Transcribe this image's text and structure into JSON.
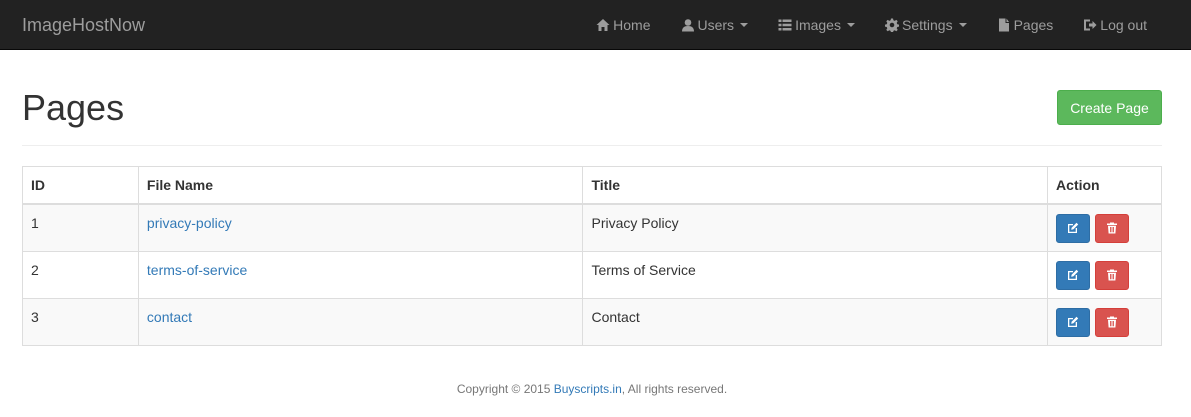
{
  "navbar": {
    "brand": "ImageHostNow",
    "items": [
      {
        "label": "Home",
        "icon": "home-icon"
      },
      {
        "label": "Users",
        "icon": "user-icon",
        "dropdown": true
      },
      {
        "label": "Images",
        "icon": "list-icon",
        "dropdown": true
      },
      {
        "label": "Settings",
        "icon": "gear-icon",
        "dropdown": true
      },
      {
        "label": "Pages",
        "icon": "file-icon"
      },
      {
        "label": "Log out",
        "icon": "logout-icon"
      }
    ]
  },
  "header": {
    "title": "Pages",
    "create_label": "Create Page"
  },
  "table": {
    "columns": [
      "ID",
      "File Name",
      "Title",
      "Action"
    ],
    "rows": [
      {
        "id": "1",
        "file": "privacy-policy",
        "title": "Privacy Policy"
      },
      {
        "id": "2",
        "file": "terms-of-service",
        "title": "Terms of Service"
      },
      {
        "id": "3",
        "file": "contact",
        "title": "Contact"
      }
    ]
  },
  "footer": {
    "prefix": "Copyright © 2015 ",
    "link": "Buyscripts.in",
    "suffix": ", All rights reserved."
  },
  "colors": {
    "navbar_bg": "#222222",
    "success": "#5cb85c",
    "primary": "#337ab7",
    "danger": "#d9534f"
  }
}
